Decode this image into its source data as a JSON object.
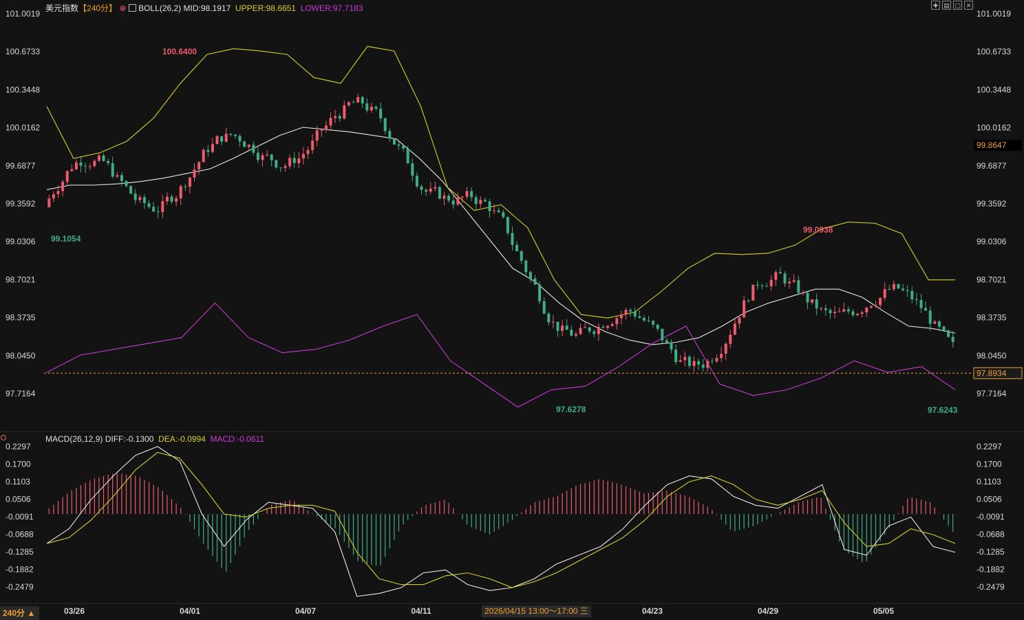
{
  "header": {
    "symbol": "美元指数",
    "period": "【240分】",
    "boll_label": "BOLL(26,2)",
    "mid": "MID:98.1917",
    "upper": "UPPER:98.6651",
    "lower": "LOWER:97.7183"
  },
  "macd_header": {
    "title": "MACD(26,12,9)",
    "diff": "DIFF:-0.1300",
    "dea": "DEA:-0.0994",
    "macd": "MACD:-0.0611"
  },
  "footer": {
    "period_button": "240分 ▲",
    "crosshair_time": "2026/04/15 13:00～17:00 三"
  },
  "colors": {
    "background": "#131313",
    "up": "#ee5c6c",
    "down": "#3fae86",
    "boll_mid": "#e8e8e8",
    "boll_upper": "#d6d02a",
    "boll_lower": "#c83bd6",
    "diff": "#e8e8e8",
    "dea": "#d6d02a",
    "current_price": "#f0a030"
  },
  "toolbar_icons": [
    "expand-icon",
    "window-icon",
    "restore-icon",
    "close-icon"
  ],
  "chart_data": [
    {
      "type": "candlestick",
      "title": "美元指数【240分】",
      "ylim": [
        97.55,
        101.1
      ],
      "y_ticks": [
        "101.0019",
        "100.6733",
        "100.3448",
        "100.0162",
        "99.6877",
        "99.3592",
        "99.0306",
        "98.7021",
        "98.3735",
        "98.0450",
        "97.7164"
      ],
      "x_ticks": [
        "03/26",
        "04/01",
        "04/07",
        "04/11",
        "04/23",
        "04/29",
        "05/05"
      ],
      "current_price": 97.8934,
      "current_price_label": "97.8934",
      "marker_price_label": "99.8647",
      "annotations": [
        {
          "label": "100.6400",
          "kind": "high"
        },
        {
          "label": "99.1054",
          "kind": "low"
        },
        {
          "label": "97.6278",
          "kind": "low"
        },
        {
          "label": "99.0938",
          "kind": "high"
        },
        {
          "label": "97.6243",
          "kind": "low"
        }
      ],
      "series": [
        {
          "name": "MID",
          "values": [
            99.48,
            99.52,
            99.52,
            99.53,
            99.55,
            99.58,
            99.62,
            99.66,
            99.75,
            99.85,
            99.95,
            100.02,
            100.0,
            99.98,
            99.95,
            99.92,
            99.75,
            99.55,
            99.3,
            99.05,
            98.8,
            98.68,
            98.5,
            98.35,
            98.25,
            98.18,
            98.14,
            98.16,
            98.2,
            98.3,
            98.42,
            98.5,
            98.56,
            98.62,
            98.62,
            98.55,
            98.42,
            98.3,
            98.28,
            98.24
          ]
        },
        {
          "name": "UPPER",
          "values": [
            100.2,
            99.75,
            99.8,
            99.9,
            100.1,
            100.4,
            100.65,
            100.7,
            100.68,
            100.65,
            100.45,
            100.4,
            100.72,
            100.68,
            100.2,
            99.5,
            99.3,
            99.35,
            99.15,
            98.7,
            98.4,
            98.37,
            98.42,
            98.6,
            98.8,
            98.93,
            98.92,
            98.93,
            99.0,
            99.14,
            99.2,
            99.19,
            99.1,
            98.7,
            98.7
          ]
        },
        {
          "name": "LOWER",
          "values": [
            97.9,
            98.05,
            98.1,
            98.15,
            98.2,
            98.5,
            98.2,
            98.07,
            98.1,
            98.18,
            98.3,
            98.4,
            98.0,
            97.8,
            97.6,
            97.75,
            97.78,
            97.95,
            98.15,
            98.3,
            97.8,
            97.7,
            97.75,
            97.85,
            98.0,
            97.9,
            97.95,
            97.75
          ]
        }
      ]
    },
    {
      "type": "bar",
      "title": "MACD(26,12,9)",
      "ylim": [
        -0.29,
        0.25
      ],
      "y_ticks": [
        "0.2297",
        "0.1700",
        "0.1103",
        "0.0506",
        "-0.0091",
        "-0.0688",
        "-0.1285",
        "-0.1882",
        "-0.2479"
      ],
      "series": [
        {
          "name": "DIFF",
          "values": [
            -0.1,
            -0.05,
            0.05,
            0.13,
            0.2,
            0.23,
            0.18,
            0.0,
            -0.11,
            -0.02,
            0.04,
            0.03,
            0.02,
            -0.06,
            -0.28,
            -0.27,
            -0.25,
            -0.2,
            -0.19,
            -0.24,
            -0.26,
            -0.25,
            -0.22,
            -0.17,
            -0.14,
            -0.11,
            -0.05,
            0.03,
            0.1,
            0.13,
            0.12,
            0.06,
            0.03,
            0.02,
            0.06,
            0.1,
            -0.12,
            -0.14,
            -0.04,
            -0.01,
            -0.11,
            -0.13
          ]
        },
        {
          "name": "DEA",
          "values": [
            -0.1,
            -0.08,
            -0.02,
            0.06,
            0.15,
            0.21,
            0.19,
            0.1,
            0.0,
            -0.01,
            0.02,
            0.03,
            0.03,
            0.01,
            -0.13,
            -0.22,
            -0.24,
            -0.24,
            -0.21,
            -0.2,
            -0.22,
            -0.25,
            -0.23,
            -0.2,
            -0.16,
            -0.12,
            -0.08,
            -0.02,
            0.06,
            0.11,
            0.13,
            0.1,
            0.05,
            0.03,
            0.05,
            0.08,
            -0.03,
            -0.11,
            -0.1,
            -0.05,
            -0.07,
            -0.1
          ]
        },
        {
          "name": "MACD",
          "values": [
            0.02,
            0.08,
            0.12,
            0.14,
            0.13,
            0.09,
            0.02,
            -0.1,
            -0.2,
            -0.06,
            0.03,
            0.05,
            0.0,
            -0.05,
            -0.16,
            -0.18,
            -0.04,
            0.03,
            0.05,
            -0.04,
            -0.07,
            -0.02,
            0.04,
            0.06,
            0.1,
            0.12,
            0.1,
            0.07,
            0.08,
            0.06,
            0.02,
            -0.06,
            -0.04,
            0.0,
            0.04,
            0.06,
            -0.12,
            -0.17,
            -0.06,
            0.06,
            0.04,
            -0.06
          ]
        }
      ]
    }
  ]
}
